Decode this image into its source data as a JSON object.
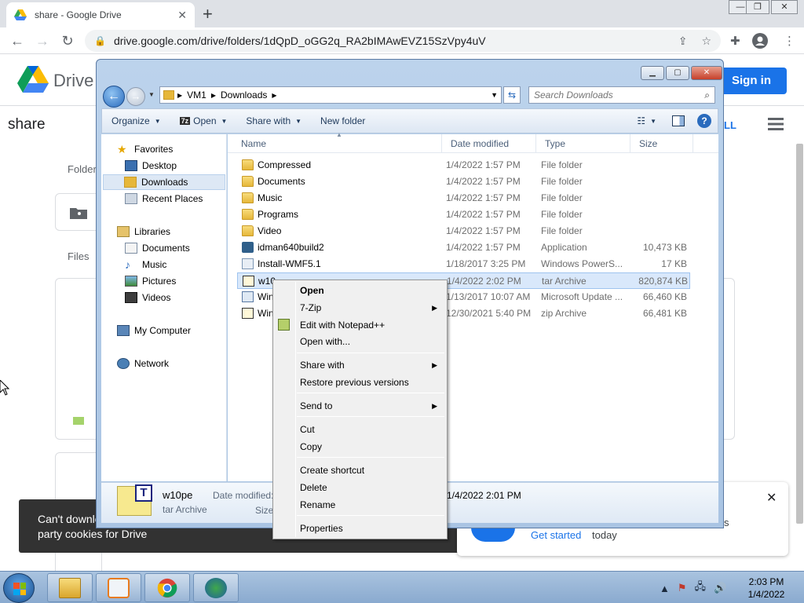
{
  "browser": {
    "tab_title": "share - Google Drive",
    "tab_close": "✕",
    "new_tab": "+",
    "url": "drive.google.com/drive/folders/1dQpD_oGG2q_RA2bIMAwEVZ15SzVpy4uV",
    "window_controls": [
      "—",
      "❐",
      "✕"
    ]
  },
  "drive": {
    "brand": "Drive",
    "sign_in": "Sign in",
    "page_title": "share",
    "all_link": "LL",
    "folders_label": "Folder",
    "files_label": "Files",
    "toast_line1": "Can't downlo",
    "toast_line2": "party cookies for Drive",
    "promo_link": "Get started",
    "promo_text": "today",
    "promo_close": "✕",
    "promo_trail": "s"
  },
  "explorer": {
    "path": [
      "VM1",
      "Downloads"
    ],
    "search_placeholder": "Search Downloads",
    "commands": {
      "organize": "Organize",
      "open": "Open",
      "share_with": "Share with",
      "new_folder": "New folder"
    },
    "nav": {
      "favorites": "Favorites",
      "desktop": "Desktop",
      "downloads": "Downloads",
      "recent_places": "Recent Places",
      "libraries": "Libraries",
      "documents": "Documents",
      "music": "Music",
      "pictures": "Pictures",
      "videos": "Videos",
      "my_computer": "My Computer",
      "network": "Network"
    },
    "columns": {
      "name": "Name",
      "date": "Date modified",
      "type": "Type",
      "size": "Size"
    },
    "files": [
      {
        "name": "Compressed",
        "date": "1/4/2022 1:57 PM",
        "type": "File folder",
        "size": "",
        "icon": "folder"
      },
      {
        "name": "Documents",
        "date": "1/4/2022 1:57 PM",
        "type": "File folder",
        "size": "",
        "icon": "folder"
      },
      {
        "name": "Music",
        "date": "1/4/2022 1:57 PM",
        "type": "File folder",
        "size": "",
        "icon": "folder"
      },
      {
        "name": "Programs",
        "date": "1/4/2022 1:57 PM",
        "type": "File folder",
        "size": "",
        "icon": "folder"
      },
      {
        "name": "Video",
        "date": "1/4/2022 1:57 PM",
        "type": "File folder",
        "size": "",
        "icon": "folder"
      },
      {
        "name": "idman640build2",
        "date": "1/4/2022 1:57 PM",
        "type": "Application",
        "size": "10,473 KB",
        "icon": "app"
      },
      {
        "name": "Install-WMF5.1",
        "date": "1/18/2017 3:25 PM",
        "type": "Windows PowerS...",
        "size": "17 KB",
        "icon": "ps"
      },
      {
        "name": "w10",
        "date": "1/4/2022 2:02 PM",
        "type": "tar Archive",
        "size": "820,874 KB",
        "icon": "tar"
      },
      {
        "name": "Win",
        "date": "1/13/2017 10:07 AM",
        "type": "Microsoft Update ...",
        "size": "66,460 KB",
        "icon": "msu"
      },
      {
        "name": "Win",
        "date": "12/30/2021 5:40 PM",
        "type": "zip Archive",
        "size": "66,481 KB",
        "icon": "zip"
      }
    ],
    "details": {
      "name": "w10pe",
      "type": "tar Archive",
      "modified_label": "Date modified:",
      "size_label": "Size:",
      "modified_value": "1/4/2022 2:01 PM"
    }
  },
  "context_menu": {
    "open": "Open",
    "seven_zip": "7-Zip",
    "edit_notepad": "Edit with Notepad++",
    "open_with": "Open with...",
    "share_with": "Share with",
    "restore": "Restore previous versions",
    "send_to": "Send to",
    "cut": "Cut",
    "copy": "Copy",
    "create_shortcut": "Create shortcut",
    "delete": "Delete",
    "rename": "Rename",
    "properties": "Properties"
  },
  "taskbar": {
    "time": "2:03 PM",
    "date": "1/4/2022"
  },
  "colors": {
    "drive_blue": "#1a73e8",
    "explorer_frame": "#bcd3ec",
    "selection": "#d9e8fb"
  }
}
